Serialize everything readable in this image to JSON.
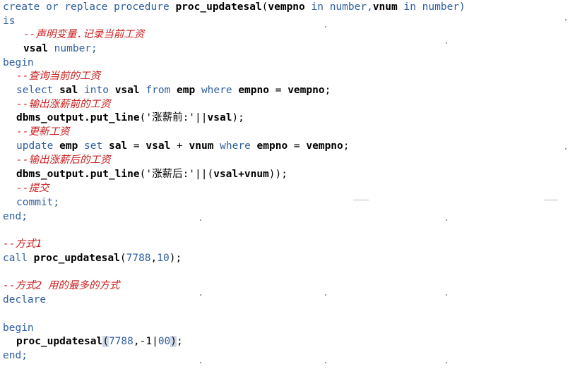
{
  "editor": {
    "lines": [
      {
        "tokens": [
          {
            "t": "create or replace procedure ",
            "c": "kw"
          },
          {
            "t": "proc_updatesal",
            "c": "id"
          },
          {
            "t": "(",
            "c": "plain"
          },
          {
            "t": "vempno",
            "c": "id"
          },
          {
            "t": " in number,",
            "c": "kw"
          },
          {
            "t": "vnum",
            "c": "id"
          },
          {
            "t": " in number)",
            "c": "kw"
          }
        ]
      },
      {
        "tokens": [
          {
            "t": "is",
            "c": "kw"
          }
        ]
      },
      {
        "tokens": [
          {
            "t": "--声明变量.记录当前工资",
            "c": "cm"
          }
        ]
      },
      {
        "tokens": [
          {
            "t": "vsal",
            "c": "id"
          },
          {
            "t": " number;",
            "c": "kw"
          }
        ]
      },
      {
        "tokens": [
          {
            "t": "begin",
            "c": "kw"
          }
        ]
      },
      {
        "tokens": [
          {
            "t": "--查询当前的工资",
            "c": "cm"
          }
        ]
      },
      {
        "tokens": [
          {
            "t": "select ",
            "c": "kw"
          },
          {
            "t": "sal",
            "c": "id"
          },
          {
            "t": " into ",
            "c": "kw"
          },
          {
            "t": "vsal",
            "c": "id"
          },
          {
            "t": " from ",
            "c": "kw"
          },
          {
            "t": "emp",
            "c": "id"
          },
          {
            "t": " where ",
            "c": "kw"
          },
          {
            "t": "empno",
            "c": "id"
          },
          {
            "t": " = ",
            "c": "plain"
          },
          {
            "t": "vempno",
            "c": "id"
          },
          {
            "t": ";",
            "c": "plain"
          }
        ]
      },
      {
        "tokens": [
          {
            "t": "--输出涨薪前的工资",
            "c": "cm"
          }
        ]
      },
      {
        "tokens": [
          {
            "t": "dbms_output.put_line",
            "c": "id"
          },
          {
            "t": "('涨薪前:'||",
            "c": "str"
          },
          {
            "t": "vsal",
            "c": "id"
          },
          {
            "t": ");",
            "c": "plain"
          }
        ]
      },
      {
        "tokens": [
          {
            "t": "--更新工资",
            "c": "cm"
          }
        ]
      },
      {
        "tokens": [
          {
            "t": "update ",
            "c": "kw"
          },
          {
            "t": "emp",
            "c": "id"
          },
          {
            "t": " set ",
            "c": "kw"
          },
          {
            "t": "sal",
            "c": "id"
          },
          {
            "t": " = ",
            "c": "plain"
          },
          {
            "t": "vsal",
            "c": "id"
          },
          {
            "t": " + ",
            "c": "plain"
          },
          {
            "t": "vnum",
            "c": "id"
          },
          {
            "t": " where ",
            "c": "kw"
          },
          {
            "t": "empno",
            "c": "id"
          },
          {
            "t": " = ",
            "c": "plain"
          },
          {
            "t": "vempno",
            "c": "id"
          },
          {
            "t": ";",
            "c": "plain"
          }
        ]
      },
      {
        "tokens": [
          {
            "t": "--输出涨薪后的工资",
            "c": "cm"
          }
        ]
      },
      {
        "tokens": [
          {
            "t": "dbms_output.put_line",
            "c": "id"
          },
          {
            "t": "('涨薪后:'||(",
            "c": "str"
          },
          {
            "t": "vsal+vnum",
            "c": "id"
          },
          {
            "t": "));",
            "c": "plain"
          }
        ]
      },
      {
        "tokens": [
          {
            "t": "--提交",
            "c": "cm"
          }
        ]
      },
      {
        "tokens": [
          {
            "t": "commit;",
            "c": "kw"
          }
        ]
      },
      {
        "tokens": [
          {
            "t": "end;",
            "c": "kw"
          }
        ]
      },
      {
        "tokens": []
      },
      {
        "tokens": [
          {
            "t": "--方式1",
            "c": "cm"
          }
        ]
      },
      {
        "tokens": [
          {
            "t": "call ",
            "c": "kw"
          },
          {
            "t": "proc_updatesal",
            "c": "id"
          },
          {
            "t": "(",
            "c": "plain"
          },
          {
            "t": "7788",
            "c": "num"
          },
          {
            "t": ",",
            "c": "plain"
          },
          {
            "t": "10",
            "c": "num"
          },
          {
            "t": ");",
            "c": "plain"
          }
        ]
      },
      {
        "tokens": []
      },
      {
        "tokens": [
          {
            "t": "--方式2 用的最多的方式",
            "c": "cm"
          }
        ]
      },
      {
        "tokens": [
          {
            "t": "declare",
            "c": "kw"
          }
        ]
      },
      {
        "tokens": []
      },
      {
        "tokens": [
          {
            "t": "begin",
            "c": "kw"
          }
        ]
      },
      {
        "tokens": [
          {
            "t": "proc_updatesal",
            "c": "id"
          },
          {
            "t": "(",
            "c": "sel"
          },
          {
            "t": "7788",
            "c": "num"
          },
          {
            "t": ",-1",
            "c": "plain"
          },
          {
            "t": "|",
            "c": "caret"
          },
          {
            "t": "00",
            "c": "num"
          },
          {
            "t": ")",
            "c": "sel"
          },
          {
            "t": ";",
            "c": "plain"
          }
        ]
      },
      {
        "tokens": [
          {
            "t": "end;",
            "c": "kw"
          }
        ]
      }
    ]
  }
}
